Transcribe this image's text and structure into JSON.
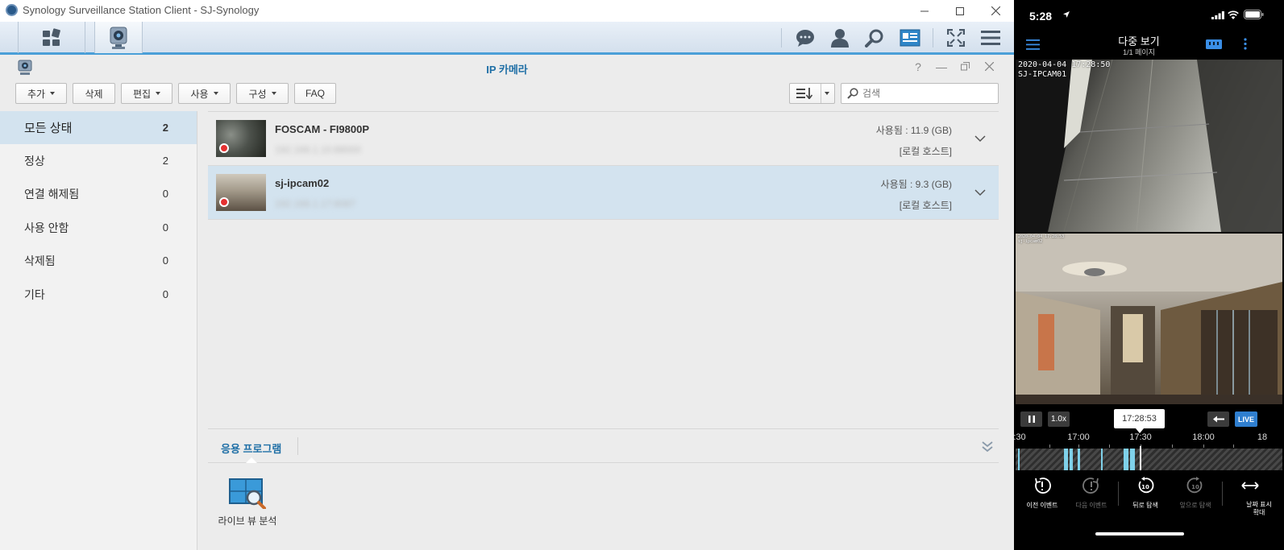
{
  "window": {
    "title": "Synology Surveillance Station Client - SJ-Synology"
  },
  "panel": {
    "title": "IP 카메라"
  },
  "toolbar": {
    "add_label": "추가",
    "delete_label": "삭제",
    "edit_label": "편집",
    "use_label": "사용",
    "config_label": "구성",
    "faq_label": "FAQ",
    "search_placeholder": "검색"
  },
  "sidebar": {
    "items": [
      {
        "label": "모든 상태",
        "count": "2",
        "active": true
      },
      {
        "label": "정상",
        "count": "2"
      },
      {
        "label": "연결 해제됨",
        "count": "0"
      },
      {
        "label": "사용 안함",
        "count": "0"
      },
      {
        "label": "삭제됨",
        "count": "0"
      },
      {
        "label": "기타",
        "count": "0"
      }
    ]
  },
  "cameras": [
    {
      "name": "FOSCAM - FI9800P",
      "ip": "192.168.1.10:88000",
      "used": "사용됨 : 11.9 (GB)",
      "host": "[로컬 호스트]"
    },
    {
      "name": "sj-ipcam02",
      "ip": "192.168.1.17:8087",
      "used": "사용됨 : 9.3 (GB)",
      "host": "[로컬 호스트]",
      "selected": true
    }
  ],
  "apps": {
    "tab_label": "응용 프로그램",
    "tile_label": "라이브 뷰 분석"
  },
  "phone": {
    "time": "5:28",
    "title": "다중 보기",
    "subtitle": "1/1 페이지",
    "feeds": [
      {
        "osd_line1": "2020-04-04 17:28:50",
        "osd_line2": "SJ-IPCAM01"
      },
      {
        "osd_line1": "2020-04-04 17:28:53",
        "osd_line2": "sj-ipcam02"
      }
    ],
    "speed": "1.0x",
    "current_time": "17:28:53",
    "live_label": "LIVE",
    "axis": [
      {
        "label": ":30",
        "pos": 0
      },
      {
        "label": "17:00",
        "pos": 1
      },
      {
        "label": "17:30",
        "pos": 2
      },
      {
        "label": "18:00",
        "pos": 3
      },
      {
        "label": "18",
        "pos": 4
      }
    ],
    "actions": [
      {
        "label": "이전 이벤트",
        "dim": false
      },
      {
        "label": "다음 이벤트",
        "dim": true
      },
      {
        "label": "뒤로 탐색",
        "dim": false
      },
      {
        "label": "앞으로 탐색",
        "dim": true
      },
      {
        "label": "날짜 표시 확대",
        "dim": false
      }
    ]
  },
  "colors": {
    "accent": "#1f6fa6",
    "selected_row": "#d3e3ef",
    "timeline_record": "#7fd1ea",
    "recording_dot": "#e53030"
  }
}
